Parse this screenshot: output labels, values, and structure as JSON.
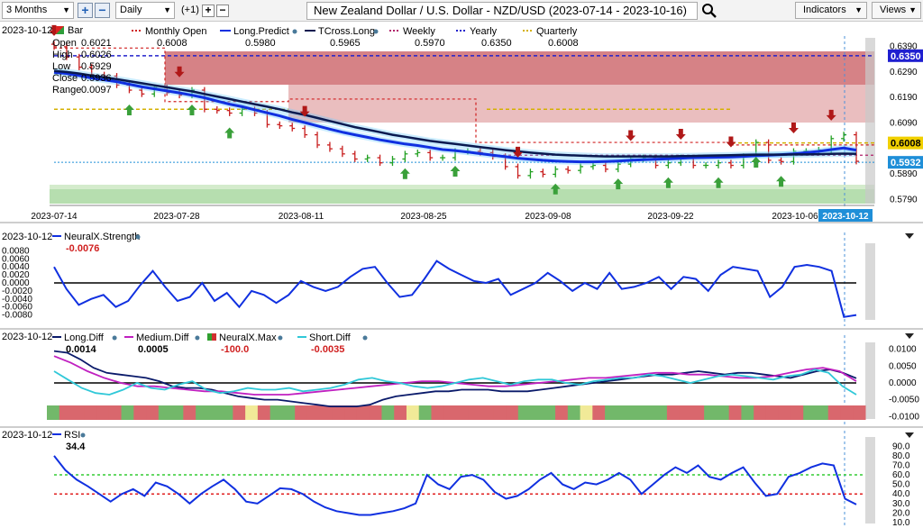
{
  "toolbar": {
    "period": "3 Months",
    "interval": "Daily",
    "offset": "(+1)",
    "title": "New Zealand Dollar / U.S. Dollar - NZD/USD (2023-07-14 - 2023-10-16)",
    "indicators_label": "Indicators",
    "views_label": "Views",
    "colors": {
      "accent": "#1f5fb5"
    }
  },
  "main_panel": {
    "date": "2023-10-12",
    "bar_title": "Bar",
    "ohlc": [
      {
        "label": "Open",
        "value": "0.6021"
      },
      {
        "label": "High",
        "value": "0.6026"
      },
      {
        "label": "Low",
        "value": "0.5929"
      },
      {
        "label": "Close",
        "value": "0.5936"
      },
      {
        "label": "Range",
        "value": "0.0097"
      }
    ],
    "legend": [
      {
        "name": "Monthly Open",
        "value": "0.6008",
        "color": "#d02020",
        "dash": true
      },
      {
        "name": "Long.Predict",
        "value": "0.5980",
        "color": "#1030e0",
        "dash": false
      },
      {
        "name": "TCross.Long",
        "value": "0.5965",
        "color": "#0a1a50",
        "dash": false
      },
      {
        "name": "Weekly",
        "value": "0.5970",
        "color": "#b0206a",
        "dash": true
      },
      {
        "name": "Yearly",
        "value": "0.6350",
        "color": "#2222cc",
        "dash": true
      },
      {
        "name": "Quarterly",
        "value": "0.6008",
        "color": "#d4b000",
        "dash": true
      }
    ],
    "y_ticks": [
      "0.6390",
      "0.6290",
      "0.6190",
      "0.6090",
      "0.5890",
      "0.5790"
    ],
    "price_tags": [
      {
        "text": "0.6350",
        "color": "#1f1fd0",
        "value": 0.635
      },
      {
        "text": "0.6008",
        "color": "#f1d000",
        "value": 0.6008
      },
      {
        "text": "0.5932",
        "color": "#1f8fd8",
        "value": 0.5932
      }
    ],
    "x_labels": [
      "2023-07-14",
      "2023-07-28",
      "2023-08-11",
      "2023-08-25",
      "2023-09-08",
      "2023-09-22",
      "2023-10-06"
    ],
    "current_date_tag": "2023-10-12"
  },
  "panels": {
    "neuralx": {
      "date": "2023-10-12",
      "name": "NeuralX.Strength",
      "value": "-0.0076",
      "y_ticks": [
        "0.0080",
        "0.0060",
        "0.0040",
        "0.0020",
        "0.0000",
        "-0.0020",
        "-0.0040",
        "-0.0060",
        "-0.0080"
      ]
    },
    "diff": {
      "date": "2023-10-12",
      "legend": [
        {
          "name": "Long.Diff",
          "value": "0.0014",
          "color": "#0a1a6a",
          "value_color": "#000000"
        },
        {
          "name": "Medium.Diff",
          "value": "0.0005",
          "color": "#c020c0",
          "value_color": "#000000"
        },
        {
          "name": "NeuralX.Max",
          "value": "-100.0",
          "color": "#d03030",
          "value_color": "#d02020"
        },
        {
          "name": "Short.Diff",
          "value": "-0.0035",
          "color": "#30c8d8",
          "value_color": "#d02020"
        }
      ],
      "y_ticks": [
        "0.0100",
        "0.0050",
        "0.0000",
        "-0.0050",
        "-0.0100"
      ]
    },
    "rsi": {
      "date": "2023-10-12",
      "name": "RSI",
      "value": "34.4",
      "y_ticks": [
        "90.0",
        "80.0",
        "70.0",
        "60.0",
        "50.0",
        "40.0",
        "30.0",
        "20.0",
        "10.0"
      ]
    }
  },
  "chart_data": [
    {
      "type": "candlestick",
      "title": "New Zealand Dollar / U.S. Dollar - NZD/USD (2023-07-14 - 2023-10-16)",
      "ylim": [
        0.577,
        0.642
      ],
      "x": [
        "2023-07-14",
        "2023-07-17",
        "2023-07-18",
        "2023-07-19",
        "2023-07-20",
        "2023-07-21",
        "2023-07-24",
        "2023-07-25",
        "2023-07-26",
        "2023-07-27",
        "2023-07-28",
        "2023-07-31",
        "2023-08-01",
        "2023-08-02",
        "2023-08-03",
        "2023-08-04",
        "2023-08-07",
        "2023-08-08",
        "2023-08-09",
        "2023-08-10",
        "2023-08-11",
        "2023-08-14",
        "2023-08-15",
        "2023-08-16",
        "2023-08-17",
        "2023-08-18",
        "2023-08-21",
        "2023-08-22",
        "2023-08-23",
        "2023-08-24",
        "2023-08-25",
        "2023-08-28",
        "2023-08-29",
        "2023-08-30",
        "2023-08-31",
        "2023-09-01",
        "2023-09-04",
        "2023-09-05",
        "2023-09-06",
        "2023-09-07",
        "2023-09-08",
        "2023-09-11",
        "2023-09-12",
        "2023-09-13",
        "2023-09-14",
        "2023-09-15",
        "2023-09-18",
        "2023-09-19",
        "2023-09-20",
        "2023-09-21",
        "2023-09-22",
        "2023-09-25",
        "2023-09-26",
        "2023-09-27",
        "2023-09-28",
        "2023-09-29",
        "2023-10-02",
        "2023-10-03",
        "2023-10-04",
        "2023-10-05",
        "2023-10-06",
        "2023-10-09",
        "2023-10-10",
        "2023-10-11",
        "2023-10-12"
      ],
      "close": [
        0.6385,
        0.6345,
        0.6305,
        0.6275,
        0.627,
        0.6235,
        0.6215,
        0.62,
        0.6225,
        0.6205,
        0.6195,
        0.6215,
        0.614,
        0.6135,
        0.6125,
        0.614,
        0.6125,
        0.608,
        0.6075,
        0.6065,
        0.604,
        0.6,
        0.5985,
        0.5965,
        0.5945,
        0.595,
        0.593,
        0.5945,
        0.5965,
        0.597,
        0.595,
        0.595,
        0.5975,
        0.5975,
        0.597,
        0.5955,
        0.5915,
        0.588,
        0.5895,
        0.5885,
        0.5905,
        0.59,
        0.5915,
        0.592,
        0.5905,
        0.5925,
        0.5945,
        0.595,
        0.592,
        0.593,
        0.595,
        0.592,
        0.592,
        0.593,
        0.592,
        0.5955,
        0.601,
        0.594,
        0.5935,
        0.5975,
        0.5975,
        0.598,
        0.6025,
        0.604,
        0.5936
      ],
      "series": [
        {
          "name": "Long.Predict",
          "values": [
            0.6285,
            0.628,
            0.6272,
            0.6262,
            0.6255,
            0.6248,
            0.6238,
            0.6228,
            0.622,
            0.6212,
            0.6204,
            0.6195,
            0.6185,
            0.6172,
            0.616,
            0.615,
            0.6138,
            0.6126,
            0.6114,
            0.61,
            0.6088,
            0.6075,
            0.6062,
            0.605,
            0.604,
            0.603,
            0.602,
            0.6012,
            0.6004,
            0.5998,
            0.599,
            0.5982,
            0.5978,
            0.5972,
            0.5966,
            0.596,
            0.5954,
            0.5948,
            0.5944,
            0.594,
            0.5937,
            0.5935,
            0.5934,
            0.5934,
            0.5935,
            0.5937,
            0.594,
            0.5942,
            0.5944,
            0.5946,
            0.5948,
            0.595,
            0.5951,
            0.5952,
            0.5953,
            0.5955,
            0.5958,
            0.596,
            0.5962,
            0.5965,
            0.597,
            0.5975,
            0.5982,
            0.5988,
            0.598
          ]
        },
        {
          "name": "TCross.Long",
          "values": [
            0.629,
            0.6286,
            0.628,
            0.6272,
            0.6265,
            0.6258,
            0.625,
            0.6242,
            0.6234,
            0.6226,
            0.6218,
            0.621,
            0.62,
            0.619,
            0.618,
            0.617,
            0.616,
            0.615,
            0.614,
            0.6128,
            0.6118,
            0.6106,
            0.6094,
            0.6082,
            0.607,
            0.606,
            0.605,
            0.604,
            0.6032,
            0.6024,
            0.6016,
            0.601,
            0.6004,
            0.5998,
            0.5992,
            0.5986,
            0.598,
            0.5975,
            0.597,
            0.5966,
            0.5962,
            0.596,
            0.5958,
            0.5956,
            0.5955,
            0.5955,
            0.5955,
            0.5955,
            0.5955,
            0.5955,
            0.5956,
            0.5957,
            0.5958,
            0.5959,
            0.596,
            0.5961,
            0.5962,
            0.5962,
            0.5962,
            0.5963,
            0.5963,
            0.5964,
            0.5965,
            0.5966,
            0.5965
          ]
        }
      ]
    },
    {
      "type": "line",
      "series": [
        {
          "name": "NeuralX.Strength",
          "values": [
            0.004,
            -0.0015,
            -0.0055,
            -0.004,
            -0.003,
            -0.006,
            -0.0045,
            -0.0005,
            0.003,
            -0.001,
            -0.0045,
            -0.0035,
            0.0,
            -0.0045,
            -0.0025,
            -0.006,
            -0.002,
            -0.003,
            -0.005,
            -0.003,
            0.0005,
            -0.001,
            -0.002,
            -0.001,
            0.0015,
            0.0035,
            0.004,
            0.0,
            -0.0035,
            -0.003,
            0.001,
            0.0055,
            0.0035,
            0.002,
            0.0005,
            0.0,
            0.001,
            -0.003,
            -0.0015,
            0.0,
            0.0025,
            0.0005,
            -0.002,
            0.0,
            -0.0015,
            0.0025,
            -0.0015,
            -0.001,
            0.0,
            0.0015,
            -0.0015,
            0.0015,
            0.001,
            -0.002,
            0.002,
            0.004,
            0.0035,
            0.003,
            -0.0035,
            -0.001,
            0.004,
            0.0045,
            0.004,
            0.003,
            -0.0085,
            -0.008
          ]
        }
      ],
      "ylim": [
        -0.009,
        0.009
      ]
    },
    {
      "type": "line",
      "series": [
        {
          "name": "Long.Diff",
          "values": [
            0.0095,
            0.009,
            0.007,
            0.0045,
            0.003,
            0.0025,
            0.002,
            0.0015,
            0.0005,
            -0.001,
            -0.0015,
            -0.0015,
            -0.002,
            -0.003,
            -0.004,
            -0.0045,
            -0.005,
            -0.005,
            -0.0055,
            -0.006,
            -0.0065,
            -0.007,
            -0.007,
            -0.007,
            -0.0065,
            -0.005,
            -0.004,
            -0.0035,
            -0.003,
            -0.0025,
            -0.0025,
            -0.002,
            -0.002,
            -0.002,
            -0.0025,
            -0.0025,
            -0.0025,
            -0.002,
            -0.0015,
            -0.001,
            -0.0005,
            0.0,
            0.0005,
            0.001,
            0.0015,
            0.002,
            0.0025,
            0.0025,
            0.003,
            0.0035,
            0.003,
            0.0025,
            0.003,
            0.003,
            0.0025,
            0.002,
            0.0015,
            0.0025,
            0.0035,
            0.004,
            0.003,
            0.0014
          ]
        },
        {
          "name": "Medium.Diff",
          "values": [
            0.008,
            0.006,
            0.0035,
            0.0015,
            0.0,
            -0.001,
            -0.001,
            -0.0015,
            -0.002,
            -0.0025,
            -0.0025,
            -0.003,
            -0.0035,
            -0.0035,
            -0.0035,
            -0.003,
            -0.0025,
            -0.002,
            -0.0015,
            -0.001,
            -0.0005,
            0.0,
            0.0005,
            0.0005,
            0.0,
            -0.0005,
            -0.001,
            -0.001,
            -0.0005,
            0.0,
            0.0005,
            0.001,
            0.0015,
            0.0015,
            0.002,
            0.0025,
            0.003,
            0.003,
            0.0025,
            0.0025,
            0.002,
            0.0015,
            0.0015,
            0.002,
            0.003,
            0.004,
            0.0045,
            0.0035,
            0.0005
          ]
        },
        {
          "name": "Short.Diff",
          "values": [
            0.0035,
            0.001,
            -0.0015,
            -0.003,
            -0.0035,
            -0.002,
            0.0,
            -0.0015,
            -0.002,
            -0.0005,
            0.0005,
            -0.002,
            -0.003,
            -0.0025,
            -0.0015,
            -0.002,
            -0.002,
            -0.0015,
            -0.0025,
            -0.002,
            -0.0015,
            -0.0005,
            0.001,
            0.0015,
            0.0005,
            0.0,
            -0.001,
            -0.0015,
            -0.001,
            0.0,
            0.001,
            0.0015,
            0.0005,
            -0.0005,
            0.0005,
            0.001,
            0.001,
            0.0,
            -0.0005,
            0.0005,
            0.001,
            0.0015,
            0.0015,
            0.0025,
            0.002,
            0.001,
            0.0,
            0.001,
            0.002,
            0.0025,
            0.002,
            0.0015,
            0.001,
            0.002,
            0.0025,
            0.004,
            0.003,
            -0.001,
            -0.0035
          ]
        }
      ],
      "neuralx_max": [
        "g",
        "r",
        "r",
        "r",
        "r",
        "r",
        "g",
        "r",
        "r",
        "g",
        "g",
        "r",
        "g",
        "g",
        "g",
        "r",
        "y",
        "r",
        "g",
        "g",
        "r",
        "r",
        "r",
        "r",
        "r",
        "r",
        "r",
        "g",
        "r",
        "y",
        "g",
        "r",
        "r",
        "r",
        "r",
        "r",
        "r",
        "r",
        "g",
        "g",
        "g",
        "r",
        "g",
        "y",
        "r",
        "g",
        "g",
        "g",
        "g",
        "g",
        "r",
        "r",
        "r",
        "g",
        "g",
        "r",
        "g",
        "r",
        "r",
        "r",
        "r",
        "g",
        "g",
        "r",
        "r",
        "r"
      ],
      "ylim": [
        -0.011,
        0.011
      ]
    },
    {
      "type": "line",
      "series": [
        {
          "name": "RSI",
          "values": [
            80,
            65,
            55,
            48,
            40,
            32,
            40,
            45,
            38,
            52,
            48,
            40,
            30,
            40,
            48,
            55,
            45,
            32,
            30,
            38,
            46,
            45,
            40,
            32,
            26,
            22,
            20,
            18,
            18,
            20,
            22,
            25,
            30,
            60,
            50,
            45,
            58,
            60,
            55,
            42,
            35,
            38,
            45,
            55,
            62,
            50,
            45,
            52,
            50,
            55,
            62,
            55,
            40,
            50,
            60,
            68,
            62,
            70,
            58,
            55,
            62,
            68,
            52,
            38,
            40,
            58,
            62,
            68,
            72,
            70,
            35,
            29
          ]
        }
      ],
      "ylim": [
        10,
        95
      ],
      "levels": [
        {
          "value": 60,
          "color": "#33cc33"
        },
        {
          "value": 40,
          "color": "#e02020"
        }
      ]
    }
  ]
}
